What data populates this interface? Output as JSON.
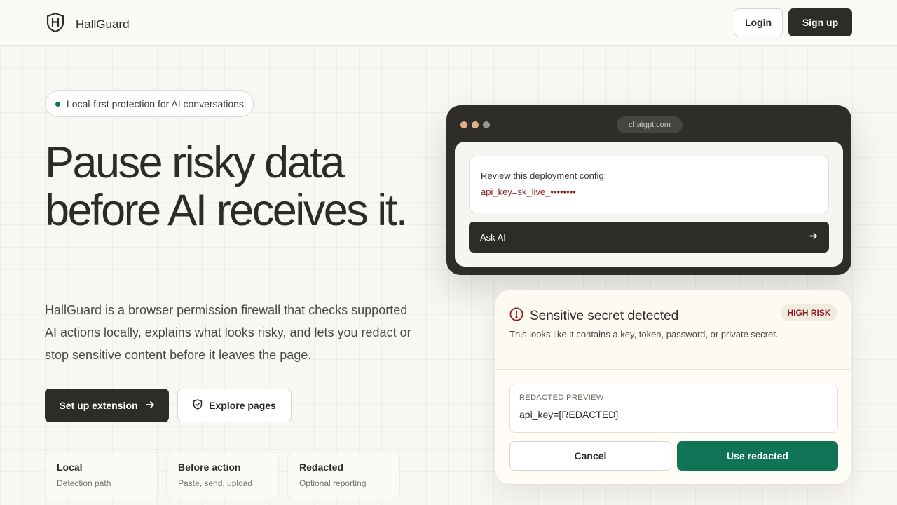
{
  "header": {
    "brand": "HallGuard",
    "login_label": "Login",
    "signup_label": "Sign up"
  },
  "hero": {
    "pill_text": "Local-first protection for AI conversations",
    "title": "Pause risky data before AI receives it.",
    "description": "HallGuard is a browser permission firewall that checks supported AI actions locally, explains what looks risky, and lets you redact or stop sensitive content before it leaves the page.",
    "primary_cta": "Set up extension",
    "secondary_cta": "Explore pages"
  },
  "stats": [
    {
      "title": "Local",
      "subtitle": "Detection path"
    },
    {
      "title": "Before action",
      "subtitle": "Paste, send, upload"
    },
    {
      "title": "Redacted",
      "subtitle": "Optional reporting"
    }
  ],
  "browser": {
    "url": "chatgpt.com",
    "prompt_line1": "Review this deployment config:",
    "prompt_line2": "api_key=sk_live_••••••••",
    "ask_label": "Ask AI"
  },
  "alert": {
    "title": "Sensitive secret detected",
    "badge": "HIGH RISK",
    "description": "This looks like it contains a key, token, password, or private secret.",
    "preview_label": "REDACTED PREVIEW",
    "preview_value": "api_key=[REDACTED]",
    "cancel_label": "Cancel",
    "use_label": "Use redacted"
  },
  "colors": {
    "accent_green": "#0f7456",
    "dark": "#2d2c28",
    "danger": "#8e1f1f",
    "traffic_light_1": "#e5b089",
    "traffic_light_2": "#dcb386",
    "traffic_light_3": "#9a9893"
  },
  "icons": {
    "logo": "shield-h-icon",
    "arrow": "arrow-right-icon",
    "explore": "shield-check-icon",
    "alert": "alert-circle-icon"
  }
}
